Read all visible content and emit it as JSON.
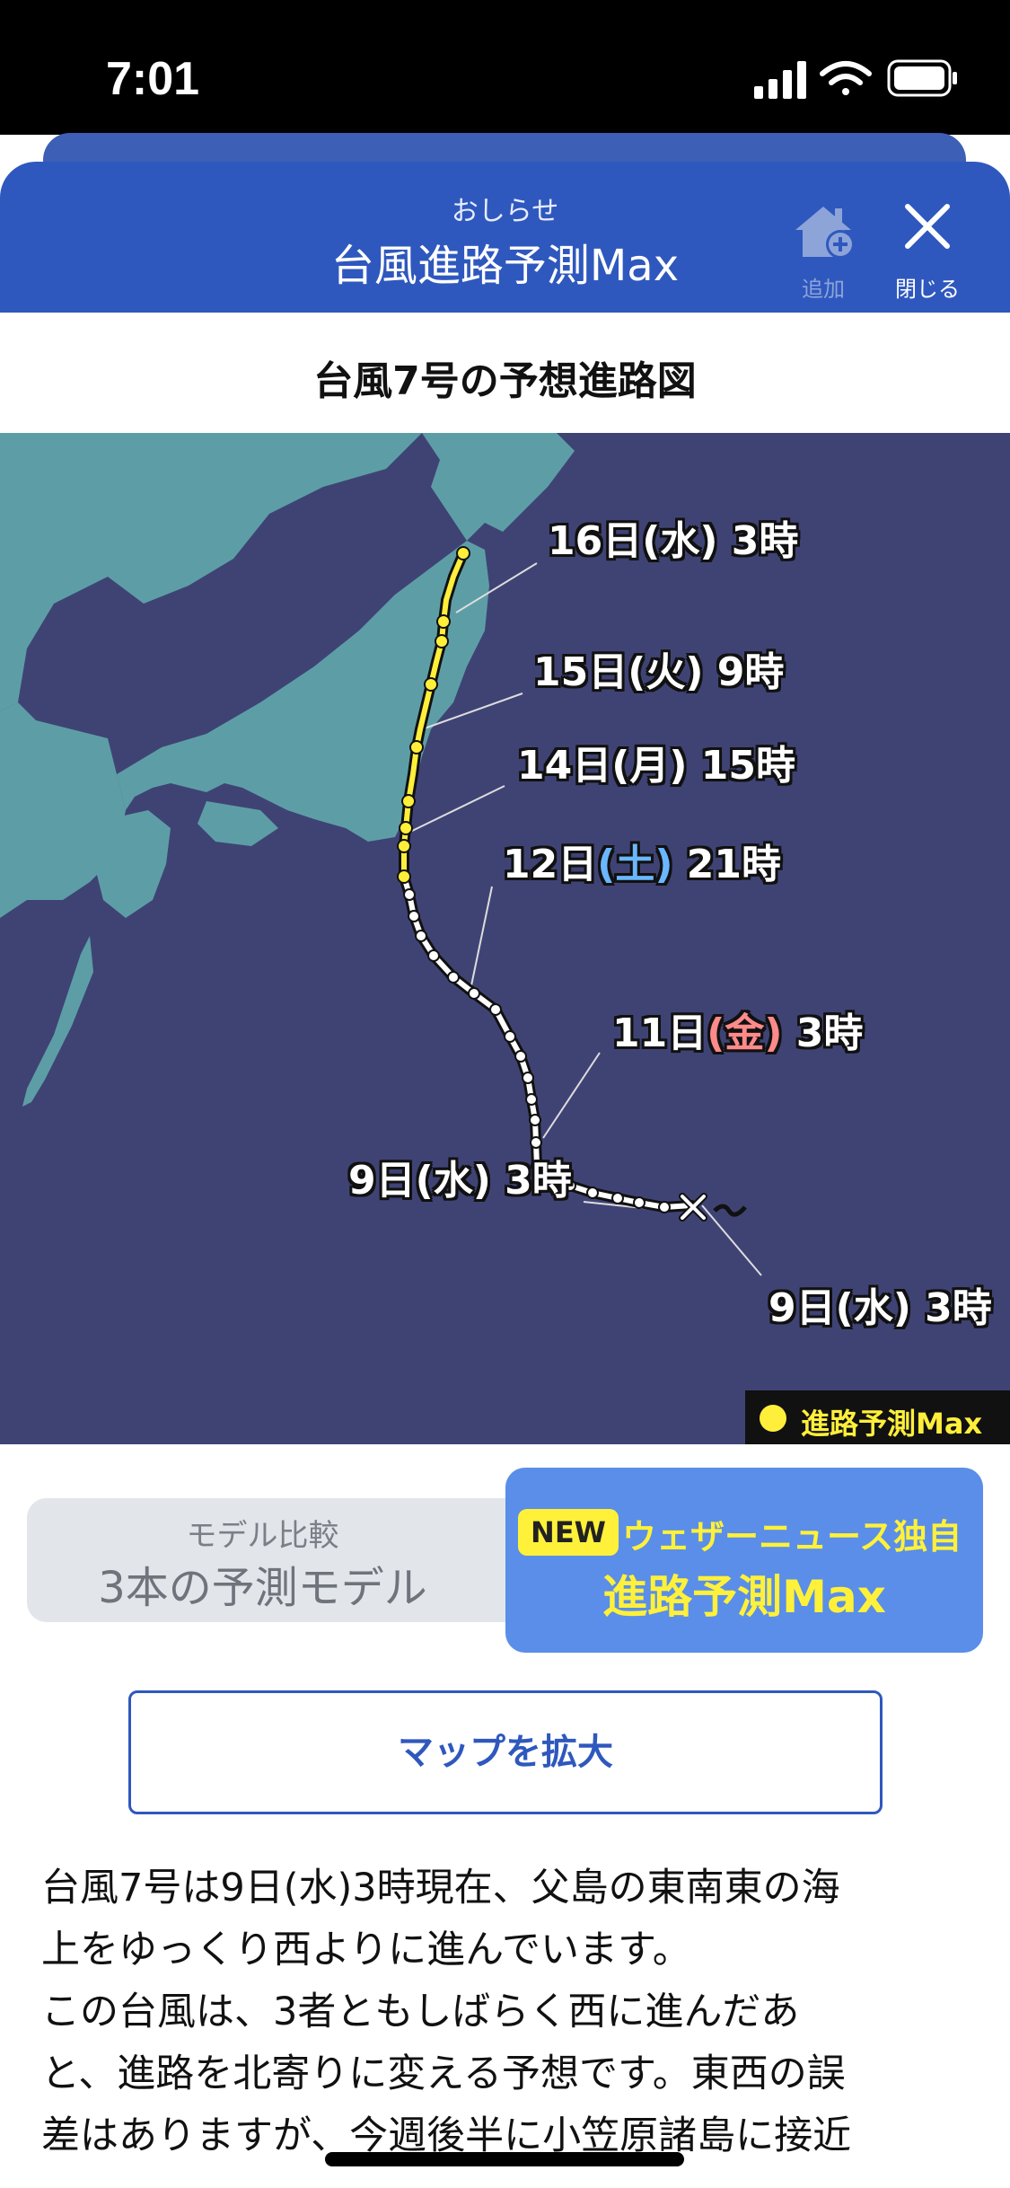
{
  "status_bar": {
    "time": "7:01"
  },
  "header": {
    "subtitle": "おしらせ",
    "title": "台風進路予測Max",
    "add_label": "追加",
    "close_label": "閉じる"
  },
  "map_title": "台風7号の予想進路図",
  "map": {
    "labels": {
      "l16": {
        "day": "16日(水)",
        "hour": "3時"
      },
      "l15": {
        "day": "15日(火)",
        "hour": "9時"
      },
      "l14": {
        "day": "14日(月)",
        "hour": "15時"
      },
      "l12": {
        "pre": "12日",
        "weekday": "(土)",
        "hour": "21時"
      },
      "l11": {
        "pre": "11日",
        "weekday": "(金)",
        "hour": "3時"
      },
      "l9a": {
        "day": "9日(水)",
        "hour": "3時"
      },
      "l9b": {
        "day": "9日(水)",
        "hour": "3時"
      }
    },
    "legend": "進路予測Max",
    "colors": {
      "sea": "#3f4374",
      "land": "#5d9ea6",
      "track_forecast": "#ffef3a",
      "track_past": "#ffffff"
    }
  },
  "tabs": {
    "compare": {
      "sub": "モデル比較",
      "main": "3本の予測モデル"
    },
    "max": {
      "badge": "NEW",
      "sub": "ウェザーニュース独自",
      "main": "進路予測Max"
    }
  },
  "expand_button": "マップを拡大",
  "body": {
    "lines": [
      "台風7号は9日(水)3時現在、父島の東南東の海",
      "上をゆっくり西よりに進んでいます。",
      "この台風は、3者ともしばらく西に進んだあ",
      "と、進路を北寄りに変える予想です。東西の誤",
      "差はありますが、今週後半に小笠原諸島に接近"
    ]
  }
}
